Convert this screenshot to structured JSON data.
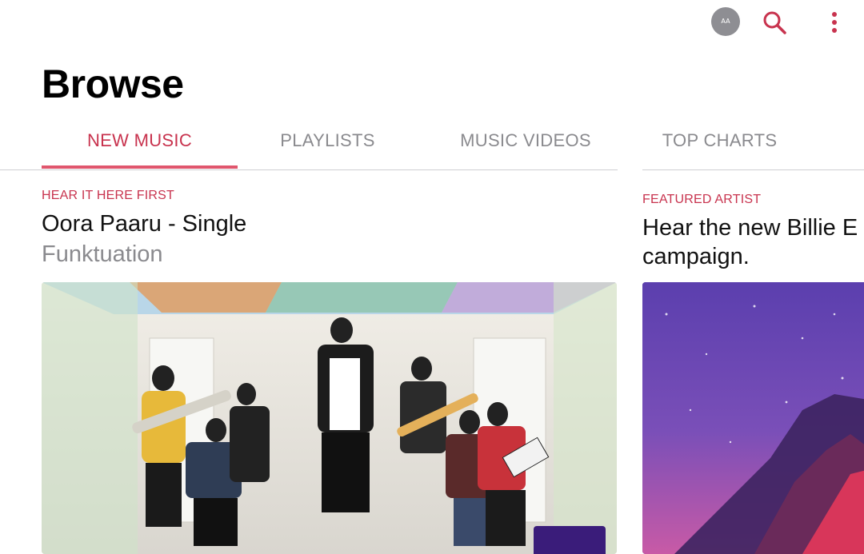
{
  "header": {
    "avatar_initials": "AA",
    "search_icon": "search-icon",
    "more_icon": "more-vertical-icon"
  },
  "page": {
    "title": "Browse"
  },
  "tabs": [
    {
      "label": "NEW MUSIC",
      "active": true
    },
    {
      "label": "PLAYLISTS",
      "active": false
    },
    {
      "label": "MUSIC VIDEOS",
      "active": false
    },
    {
      "label": "TOP CHARTS",
      "active": false
    }
  ],
  "cards": [
    {
      "eyebrow": "HEAR IT HERE FIRST",
      "title": "Oora Paaru - Single",
      "subtitle": "Funktuation"
    },
    {
      "eyebrow": "FEATURED ARTIST",
      "title": "Hear the new Billie E",
      "title_line2": "campaign."
    }
  ],
  "colors": {
    "accent": "#c8334e",
    "tab_inactive": "#8a8a8e"
  }
}
